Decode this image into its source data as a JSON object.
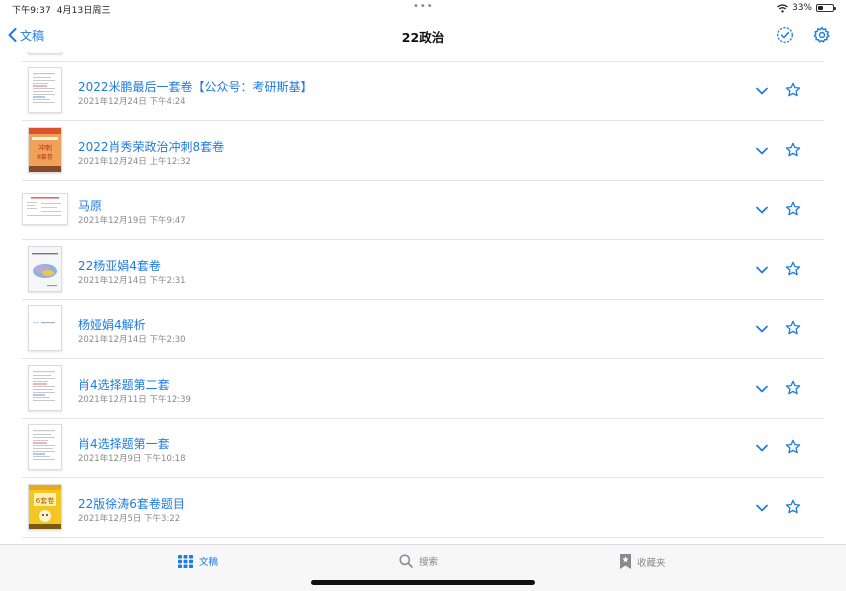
{
  "status_bar": {
    "time": "下午9:37",
    "date": "4月13日周三",
    "battery": "33%",
    "battery_level": 0.33
  },
  "nav": {
    "back_label": "文稿",
    "title": "22政治"
  },
  "documents": [
    {
      "title": "2022米鹏最后一套卷【公众号：考研斯基】",
      "date": "2021年12月24日 下午4:24",
      "thumb": "doc"
    },
    {
      "title": "2022肖秀荣政治冲刺8套卷",
      "date": "2021年12月24日 上午12:32",
      "thumb": "cover-orange"
    },
    {
      "title": "马原",
      "date": "2021年12月19日 下午9:47",
      "thumb": "wide"
    },
    {
      "title": "22杨亚娟4套卷",
      "date": "2021年12月14日 下午2:31",
      "thumb": "cover-blue"
    },
    {
      "title": "杨娅娟4解析",
      "date": "2021年12月14日 下午2:30",
      "thumb": "blank"
    },
    {
      "title": "肖4选择题第二套",
      "date": "2021年12月11日 下午12:39",
      "thumb": "doc"
    },
    {
      "title": "肖4选择题第一套",
      "date": "2021年12月9日 下午10:18",
      "thumb": "doc"
    },
    {
      "title": "22版徐涛6套卷题目",
      "date": "2021年12月5日 下午3:22",
      "thumb": "cover-yellow"
    }
  ],
  "tabs": [
    {
      "label": "文稿",
      "icon": "grid-icon",
      "active": true
    },
    {
      "label": "搜索",
      "icon": "search-icon",
      "active": false
    },
    {
      "label": "收藏夹",
      "icon": "bookmark-star-icon",
      "active": false
    }
  ],
  "colors": {
    "accent": "#1e7be0",
    "secondary_text": "#8a8a8e",
    "divider": "#e4e4e8"
  }
}
